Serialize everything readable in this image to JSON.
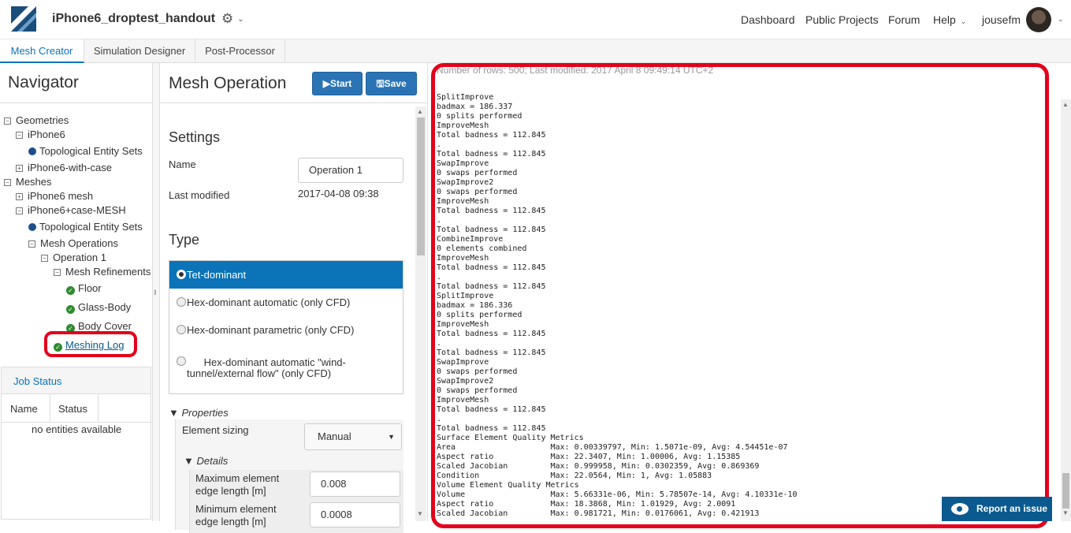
{
  "app": {
    "project_title": "iPhone6_droptest_handout",
    "settings_icon": "gear-icon",
    "nav_links": [
      "Dashboard",
      "Public Projects",
      "Forum",
      "Help",
      "jousefm"
    ]
  },
  "tabs": [
    "Mesh Creator",
    "Simulation Designer",
    "Post-Processor"
  ],
  "navigator": {
    "title": "Navigator",
    "tree": {
      "geometries": "Geometries",
      "iphone6": "iPhone6",
      "topo1": "Topological Entity Sets",
      "iphone6_case": "iPhone6-with-case",
      "meshes": "Meshes",
      "iphone6_mesh": "iPhone6 mesh",
      "iphone6_case_mesh": "iPhone6+case-MESH",
      "topo2": "Topological Entity Sets",
      "mesh_ops": "Mesh Operations",
      "op1": "Operation 1",
      "refinements": "Mesh Refinements",
      "floor": "Floor",
      "glass": "Glass-Body",
      "cover": "Body Cover",
      "log": "Meshing Log"
    },
    "job_status": {
      "title": "Job Status",
      "col_name": "Name",
      "col_status": "Status",
      "empty": "no entities available"
    }
  },
  "mesh_operation": {
    "title": "Mesh Operation",
    "start_label": "Start",
    "save_label": "Save",
    "settings_title": "Settings",
    "name_label": "Name",
    "name_value": "Operation 1",
    "last_modified_label": "Last modified",
    "last_modified_value": "2017-04-08 09:38",
    "type_title": "Type",
    "type_options": [
      "Tet-dominant",
      "Hex-dominant automatic (only CFD)",
      "Hex-dominant parametric (only CFD)",
      "Hex-dominant automatic \"wind-\ntunnel/external flow\" (only CFD)"
    ],
    "selected_type": "Tet-dominant",
    "properties_title": "Properties",
    "element_sizing_label": "Element sizing",
    "element_sizing_value": "Manual",
    "details_title": "Details",
    "max_edge_label": "Maximum element\nedge length [m]",
    "max_edge_value": "0.008",
    "min_edge_label": "Minimum element\nedge length [m]",
    "min_edge_value": "0.0008"
  },
  "log": {
    "header": "Number of rows: 500; Last modified: 2017 April 8 09:49:14 UTC+2",
    "lines": "SplitImprove\nbadmax = 186.337\n0 splits performed\nImproveMesh\nTotal badness = 112.845\n.\nTotal badness = 112.845\nSwapImprove\n0 swaps performed\nSwapImprove2\n0 swaps performed\nImproveMesh\nTotal badness = 112.845\n.\nTotal badness = 112.845\nCombineImprove\n0 elements combined\nImproveMesh\nTotal badness = 112.845\n.\nTotal badness = 112.845\nSplitImprove\nbadmax = 186.336\n0 splits performed\nImproveMesh\nTotal badness = 112.845\n.\nTotal badness = 112.845\nSwapImprove\n0 swaps performed\nSwapImprove2\n0 swaps performed\nImproveMesh\nTotal badness = 112.845\n.\nTotal badness = 112.845\nSurface Element Quality Metrics\nArea                    Max: 0.00339797, Min: 1.5071e-09, Avg: 4.54451e-07\nAspect ratio            Max: 22.3407, Min: 1.00006, Avg: 1.15385\nScaled Jacobian         Max: 0.999958, Min: 0.0302359, Avg: 0.869369\nCondition               Max: 22.0564, Min: 1, Avg: 1.05883\nVolume Element Quality Metrics\nVolume                  Max: 5.66331e-06, Min: 5.78507e-14, Avg: 4.10331e-10\nAspect ratio            Max: 18.3868, Min: 1.01929, Avg: 2.0091\nScaled Jacobian         Max: 0.981721, Min: 0.0176061, Avg: 0.421913",
    "report_label": "Report an issue"
  },
  "colors": {
    "accent": "#0b73b7",
    "highlight": "#e3001b",
    "success": "#2e8b2e"
  }
}
